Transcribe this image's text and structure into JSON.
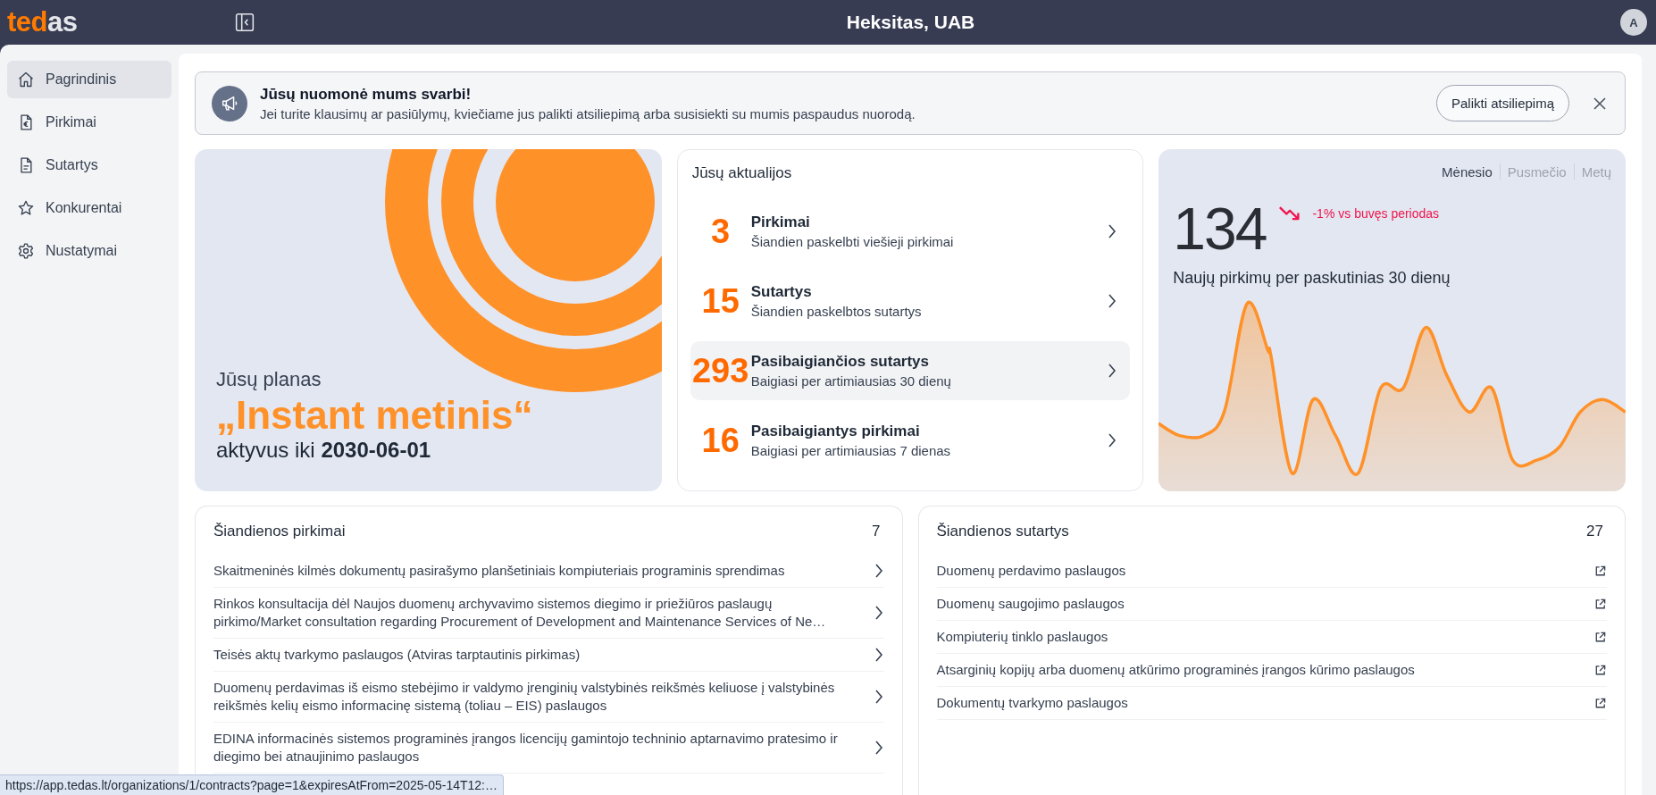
{
  "header": {
    "logo_accent": "ted",
    "logo_rest": "as",
    "company": "Heksitas, UAB",
    "avatar": "A"
  },
  "sidebar": {
    "items": [
      {
        "label": "Pagrindinis",
        "selected": true
      },
      {
        "label": "Pirkimai",
        "selected": false
      },
      {
        "label": "Sutartys",
        "selected": false
      },
      {
        "label": "Konkurentai",
        "selected": false
      },
      {
        "label": "Nustatymai",
        "selected": false
      }
    ]
  },
  "banner": {
    "title": "Jūsų nuomonė mums svarbi!",
    "text": "Jei turite klausimų ar pasiūlymų, kviečiame jus palikti atsiliepimą arba susisiekti su mumis paspaudus nuorodą.",
    "button": "Palikti atsiliepimą"
  },
  "plan": {
    "label": "Jūsų planas",
    "name": "„Instant metinis“",
    "active": "aktyvus iki **2030-06-01**"
  },
  "updates": {
    "title": "Jūsų aktualijos",
    "items": [
      {
        "count": "3",
        "title": "Pirkimai",
        "subtitle": "Šiandien paskelbti viešieji pirkimai",
        "selected": false
      },
      {
        "count": "15",
        "title": "Sutartys",
        "subtitle": "Šiandien paskelbtos sutartys",
        "selected": false
      },
      {
        "count": "293",
        "title": "Pasibaigiančios sutartys",
        "subtitle": "Baigiasi per artimiausias 30 dienų",
        "selected": true
      },
      {
        "count": "16",
        "title": "Pasibaigiantys pirkimai",
        "subtitle": "Baigiasi per artimiausias 7 dienas",
        "selected": false
      }
    ]
  },
  "stats": {
    "periods": [
      {
        "label": "Mėnesio",
        "selected": true
      },
      {
        "label": "Pusmečio",
        "selected": false
      },
      {
        "label": "Metų",
        "selected": false
      }
    ],
    "value": "134",
    "change": "-1% vs buvęs periodas",
    "caption": "Naujų pirkimų per paskutinias 30 dienų"
  },
  "today_purchases": {
    "title": "Šiandienos pirkimai",
    "count": "7",
    "items": [
      "Skaitmeninės kilmės dokumentų pasirašymo planšetiniais kompiuteriais programinis sprendimas",
      "Rinkos konsultacija dėl Naujos duomenų archyvavimo sistemos diegimo ir priežiūros paslaugų pirkimo/Market consultation regarding Procurement of Development and Maintenance Services of Ne…",
      "Teisės aktų tvarkymo paslaugos (Atviras tarptautinis pirkimas)",
      "Duomenų perdavimas iš eismo stebėjimo ir valdymo įrenginių valstybinės reikšmės keliuose į valstybinės reikšmės kelių eismo informacinę sistemą (toliau – EIS) paslaugos",
      "EDINA informacinės sistemos programinės įrangos licencijų gamintojo techninio aptarnavimo pratesimo ir diegimo bei atnaujinimo paslaugos"
    ]
  },
  "today_contracts": {
    "title": "Šiandienos sutartys",
    "count": "27",
    "items": [
      "Duomenų perdavimo paslaugos",
      "Duomenų saugojimo paslaugos",
      "Kompiuterių tinklo paslaugos",
      "Atsarginių kopijų arba duomenų atkūrimo programinės įrangos kūrimo paslaugos",
      "Dokumentų tvarkymo paslaugos"
    ]
  },
  "status_bar": {
    "url": "https://app.tedas.lt/organizations/1/contracts?page=1&expiresAtFrom=2025-05-14T12:…"
  }
}
